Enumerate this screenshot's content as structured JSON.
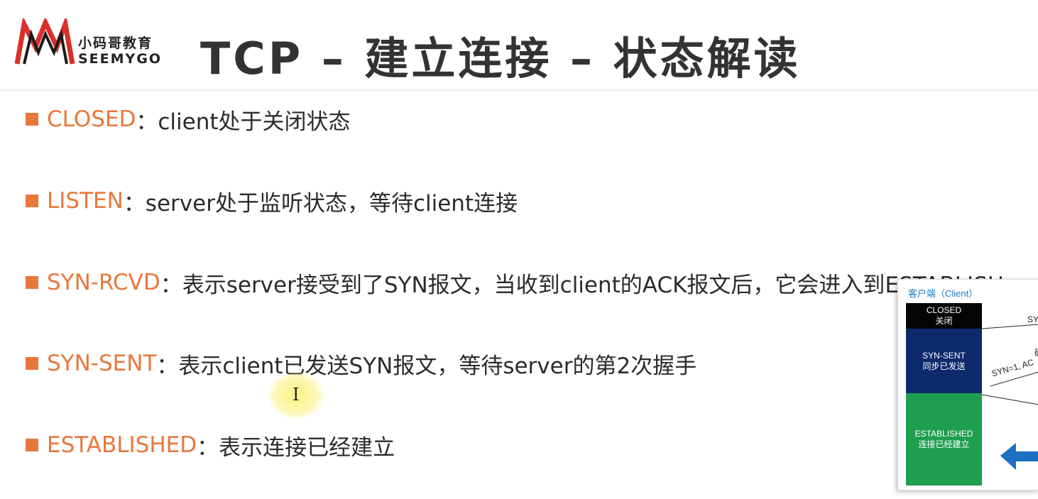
{
  "header": {
    "logo_cn": "小码哥教育",
    "logo_en": "SEEMYGO",
    "title": "TCP – 建立连接 – 状态解读"
  },
  "bullets": [
    {
      "term": "CLOSED",
      "desc": "：client处于关闭状态"
    },
    {
      "term": "LISTEN",
      "desc": "：server处于监听状态，等待client连接"
    },
    {
      "term": "SYN-RCVD",
      "desc": "：表示server接受到了SYN报文，当收到client的ACK报文后，它会进入到ESTABLISH"
    },
    {
      "term": "SYN-SENT",
      "desc": "：表示client已发送SYN报文，等待server的第2次握手"
    },
    {
      "term": "ESTABLISHED",
      "desc": "：表示连接已经建立"
    }
  ],
  "diagram": {
    "title": "客户端（Client）",
    "states": [
      {
        "en": "CLOSED",
        "cn": "关闭"
      },
      {
        "en": "SYN-SENT",
        "cn": "同步已发送"
      },
      {
        "en": "ESTABLISHED",
        "cn": "连接已经建立"
      }
    ],
    "labels": [
      "SY",
      "SYN=1, AC",
      "确"
    ]
  },
  "colors": {
    "accent": "#e8773c",
    "closed": "#050505",
    "syn_sent": "#0d2a6b",
    "established": "#1e9f4f",
    "arrow": "#1d6fc2"
  }
}
